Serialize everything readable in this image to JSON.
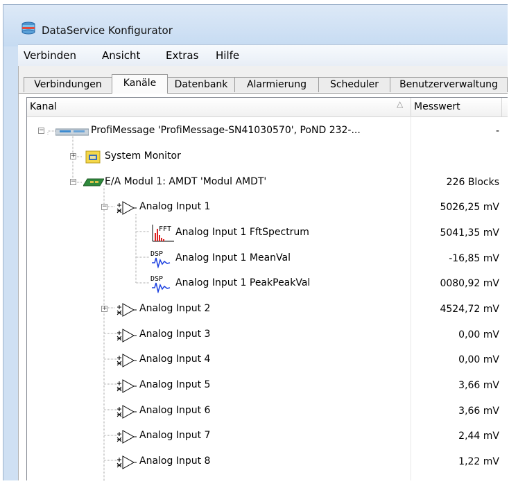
{
  "window": {
    "title": "DataService Konfigurator"
  },
  "menu": [
    "Verbinden",
    "Ansicht",
    "Extras",
    "Hilfe"
  ],
  "tabs": [
    {
      "label": "Verbindungen",
      "active": false
    },
    {
      "label": "Kanäle",
      "active": true
    },
    {
      "label": "Datenbank",
      "active": false
    },
    {
      "label": "Alarmierung",
      "active": false
    },
    {
      "label": "Scheduler",
      "active": false
    },
    {
      "label": "Benutzerverwaltung",
      "active": false
    }
  ],
  "columns": {
    "kanal": "Kanal",
    "messwert": "Messwert"
  },
  "rows": [
    {
      "label": "ProfiMessage 'ProfiMessage-SN41030570', PoND 232-...",
      "value": "-"
    },
    {
      "label": "System Monitor",
      "value": ""
    },
    {
      "label": "E/A Modul  1: AMDT 'Modul AMDT'",
      "value": "226 Blocks"
    },
    {
      "label": "Analog Input 1",
      "value": "5026,25 mV"
    },
    {
      "label": "Analog Input 1 FftSpectrum",
      "value": "5041,35 mV"
    },
    {
      "label": "Analog Input 1 MeanVal",
      "value": "-16,85 mV"
    },
    {
      "label": "Analog Input 1 PeakPeakVal",
      "value": "0080,92 mV"
    },
    {
      "label": "Analog Input 2",
      "value": "4524,72 mV"
    },
    {
      "label": "Analog Input 3",
      "value": "0,00 mV"
    },
    {
      "label": "Analog Input 4",
      "value": "0,00 mV"
    },
    {
      "label": "Analog Input 5",
      "value": "3,66 mV"
    },
    {
      "label": "Analog Input 6",
      "value": "3,66 mV"
    },
    {
      "label": "Analog Input 7",
      "value": "2,44 mV"
    },
    {
      "label": "Analog Input 8",
      "value": "1,22 mV"
    }
  ],
  "icon_labels": {
    "fft": "FFT",
    "dsp": "DSP"
  }
}
